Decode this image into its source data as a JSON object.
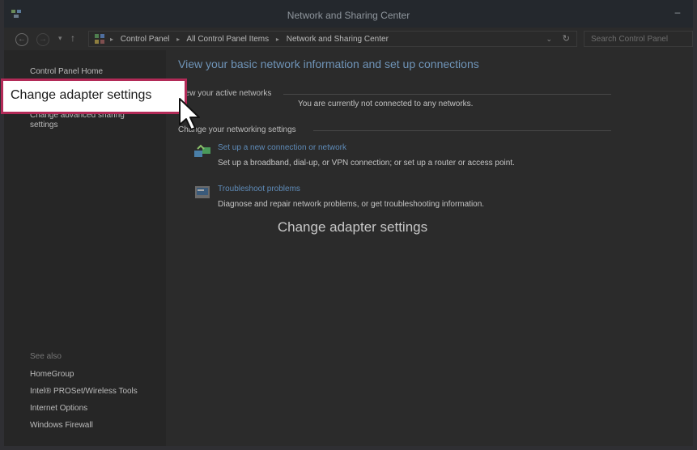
{
  "window": {
    "title": "Network and Sharing Center",
    "minimize_glyph": "–"
  },
  "address": {
    "back_glyph": "←",
    "forward_glyph": "→",
    "recent_glyph": "▾",
    "up_glyph": "↑",
    "breadcrumbs": [
      "Control Panel",
      "All Control Panel Items",
      "Network and Sharing Center"
    ],
    "separator": "▸",
    "dropdown_glyph": "⌄",
    "refresh_glyph": "↻",
    "search_placeholder": "Search Control Panel"
  },
  "sidebar": {
    "home": "Control Panel Home",
    "advanced_sharing": "Change advanced sharing settings",
    "see_also": "See also",
    "links": [
      "HomeGroup",
      "Intel® PROSet/Wireless Tools",
      "Internet Options",
      "Windows Firewall"
    ]
  },
  "main": {
    "heading": "View your basic network information and set up connections",
    "active_networks_label": "View your active networks",
    "not_connected": "You are currently not connected to any networks.",
    "settings_label": "Change your networking settings",
    "tasks": [
      {
        "link": "Set up a new connection or network",
        "description": "Set up a broadband, dial-up, or VPN connection; or set up a router or access point.",
        "icon": "network-setup-icon"
      },
      {
        "link": "Troubleshoot problems",
        "description": "Diagnose and repair network problems, or get troubleshooting information.",
        "icon": "troubleshoot-icon"
      }
    ],
    "caption": "Change adapter settings"
  },
  "callout": {
    "label": "Change adapter settings",
    "border_color": "#b22a57"
  },
  "colors": {
    "link": "#5e8bb8",
    "heading": "#6f94b8",
    "overlay_bg": "#2b2b2b"
  }
}
